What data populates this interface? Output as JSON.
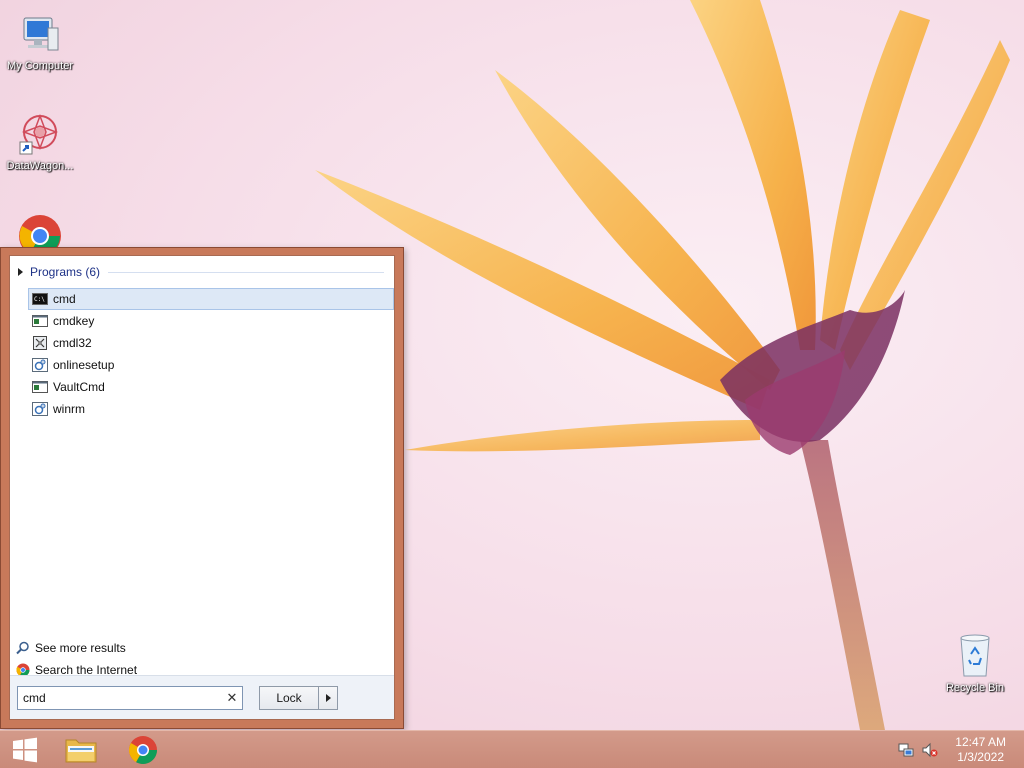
{
  "desktop": {
    "icons": [
      {
        "label": "My Computer",
        "icon": "computer-icon"
      },
      {
        "label": "DataWagon...",
        "icon": "datawagon-shortcut-icon"
      },
      {
        "label": "",
        "icon": "chrome-icon"
      },
      {
        "label": "Recycle Bin",
        "icon": "recycle-bin-icon"
      }
    ]
  },
  "start_menu": {
    "programs_header": "Programs (6)",
    "programs": [
      {
        "label": "cmd",
        "icon": "cmd-icon",
        "selected": true
      },
      {
        "label": "cmdkey",
        "icon": "console-app-icon"
      },
      {
        "label": "cmdl32",
        "icon": "cmdl32-icon"
      },
      {
        "label": "onlinesetup",
        "icon": "setup-icon"
      },
      {
        "label": "VaultCmd",
        "icon": "console-app-icon"
      },
      {
        "label": "winrm",
        "icon": "setup-icon"
      }
    ],
    "see_more": "See more results",
    "search_internet": "Search the Internet",
    "search": {
      "value": "cmd",
      "clear": "✕"
    },
    "lock_label": "Lock"
  },
  "taskbar": {
    "buttons": [
      "start-button",
      "file-explorer-button",
      "chrome-button"
    ],
    "tray": [
      "network-icon",
      "volume-muted-icon"
    ],
    "clock": {
      "time": "12:47 AM",
      "date": "1/3/2022"
    }
  },
  "colors": {
    "start_menu_frame": "#c8795a",
    "taskbar": "#c98a79",
    "selection": "#dde8f6",
    "header_text": "#1e3287"
  }
}
